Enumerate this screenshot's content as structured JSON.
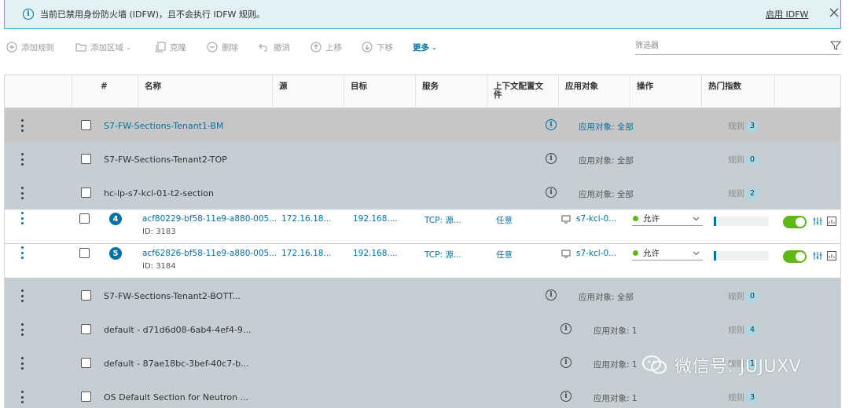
{
  "banner": {
    "message": "当前已禁用身份防火墙 (IDFW)，且不会执行 IDFW 规则。",
    "enable_link": "启用 IDFW",
    "icons": {
      "info": "info-icon",
      "close": "close-icon"
    }
  },
  "toolbar": {
    "add_rule": "添加规则",
    "add_section": "添加区域",
    "clone": "克隆",
    "delete": "删除",
    "undo": "撤消",
    "move_up": "上移",
    "move_down": "下移",
    "more": "更多",
    "filter_placeholder": "筛选器"
  },
  "columns": {
    "hash": "#",
    "name": "名称",
    "source": "源",
    "target": "目标",
    "service": "服务",
    "context_profile": "上下文配置文件",
    "applied_to": "应用对象",
    "action": "操作",
    "hit_count": "热门指数"
  },
  "sections": [
    {
      "name": "S7-FW-Sections-Tenant1-BM",
      "applied_to": "应用对象: 全部",
      "rules_label": "规则",
      "rule_count": "3"
    },
    {
      "name": "S7-FW-Sections-Tenant2-TOP",
      "applied_to": "应用对象: 全部",
      "rules_label": "规则",
      "rule_count": "0"
    },
    {
      "name": "hc-lp-s7-kcl-01-t2-section",
      "applied_to": "应用对象: 全部",
      "rules_label": "规则",
      "rule_count": "2"
    },
    {
      "name": "S7-FW-Sections-Tenant2-BOTT...",
      "applied_to": "应用对象: 全部",
      "rules_label": "规则",
      "rule_count": "0"
    },
    {
      "name": "default - d71d6d08-6ab4-4ef4-9...",
      "applied_to": "应用对象: 1",
      "rules_label": "规则",
      "rule_count": "4"
    },
    {
      "name": "default - 87ae18bc-3bef-40c7-b...",
      "applied_to": "应用对象: 1",
      "rules_label": "规则",
      "rule_count": "1"
    },
    {
      "name": "OS Default Section for Neutron ...",
      "applied_to": "应用对象: 1",
      "rules_label": "规则",
      "rule_count": "3"
    }
  ],
  "rules": [
    {
      "number": "4",
      "name": "acf80229-bf58-11e9-a880-005...",
      "id": "ID: 3183",
      "source": "172.16.18...",
      "target": "192.168....",
      "service": "TCP: 源...",
      "context_profile": "任意",
      "applied_to": "s7-kcl-0...",
      "action": "允许",
      "action_color": "#5eb715",
      "hit_fraction": 0.03,
      "enabled": true
    },
    {
      "number": "5",
      "name": "acf62826-bf58-11e9-a880-005...",
      "id": "ID: 3184",
      "source": "172.16.18...",
      "target": "192.168....",
      "service": "TCP: 源...",
      "context_profile": "任意",
      "applied_to": "s7-kcl-0...",
      "action": "允许",
      "action_color": "#5eb715",
      "hit_fraction": 0.03,
      "enabled": true
    }
  ],
  "watermark": {
    "text": "微信号: JUJUXV"
  },
  "colors": {
    "accent": "#0072a3",
    "section_bg": "#c4ced3",
    "selected_section_bg": "#c6c6c6",
    "allow_green": "#5eb715",
    "banner_bg": "#e1f1f6"
  }
}
